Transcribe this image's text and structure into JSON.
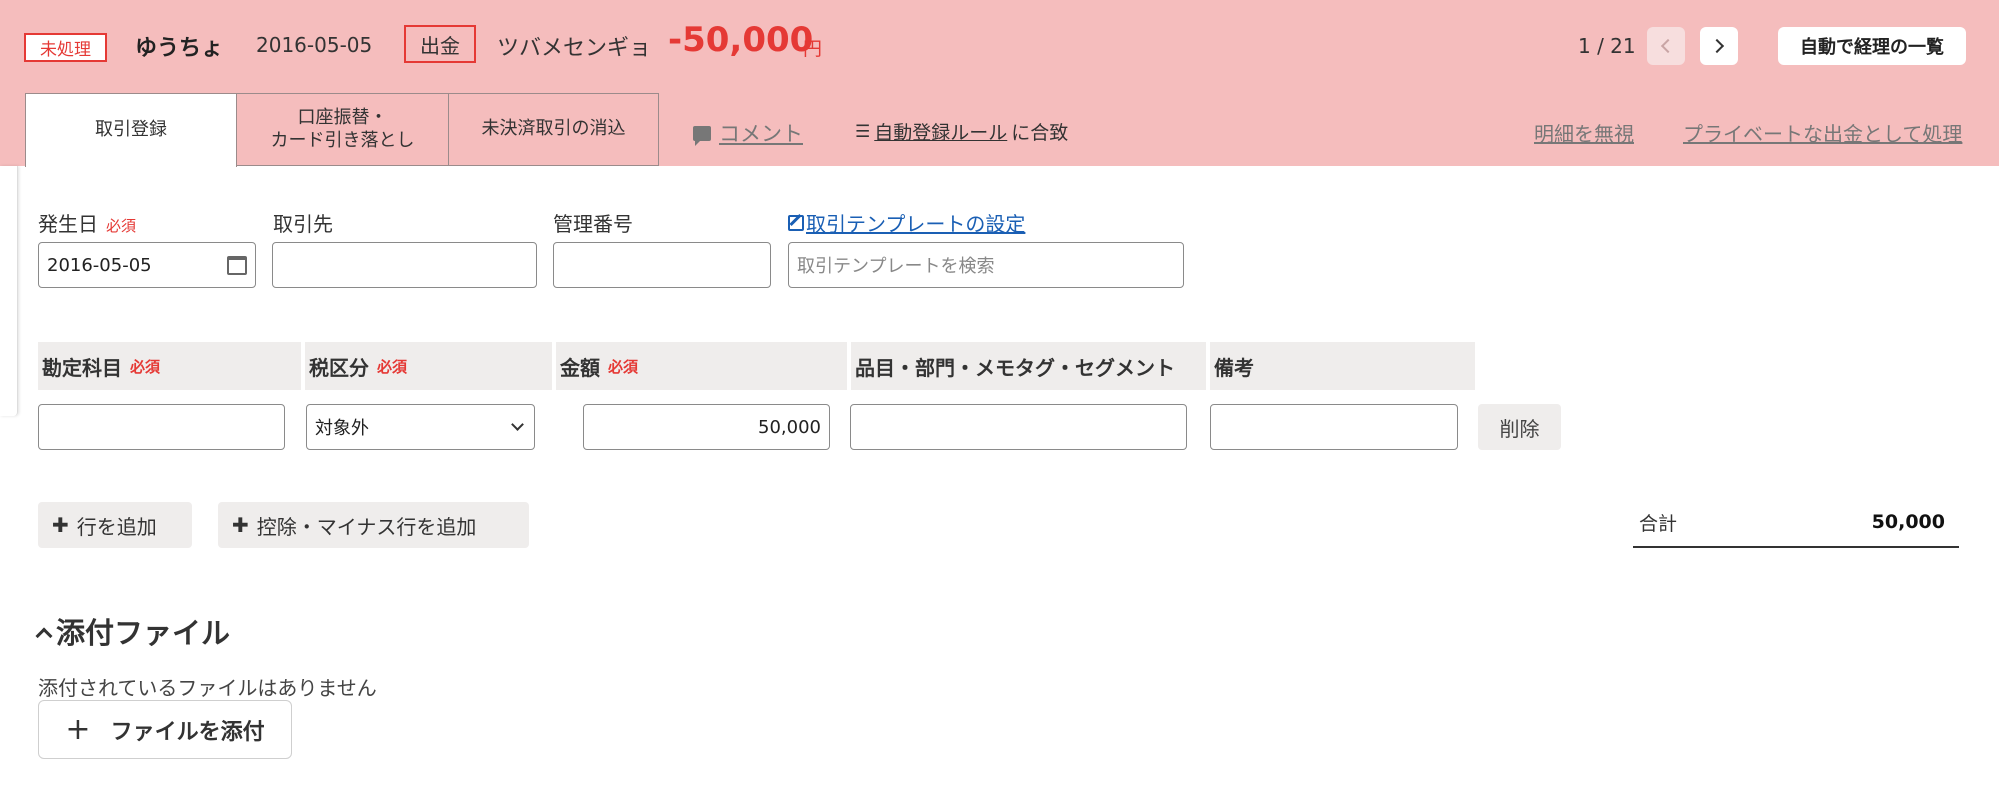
{
  "header": {
    "status": "未処理",
    "bank": "ゆうちょ",
    "date": "2016-05-05",
    "type": "出金",
    "payee": "ツバメセンギョ",
    "amount": "-50,000",
    "currency": "円",
    "pager": "1 / 21",
    "list_button": "自動で経理の一覧"
  },
  "tabs": [
    {
      "label": "取引登録",
      "active": true
    },
    {
      "label": "口座振替・\nカード引き落とし",
      "active": false
    },
    {
      "label": "未決済取引の消込",
      "active": false
    }
  ],
  "actions": {
    "comment": "コメント",
    "rule_link": "自動登録ルール",
    "rule_suffix": "に合致",
    "ignore": "明細を無視",
    "private": "プライベートな出金として処理"
  },
  "form": {
    "required": "必須",
    "date_label": "発生日",
    "date_value": "2016-05-05",
    "partner_label": "取引先",
    "partner_value": "",
    "mgmt_label": "管理番号",
    "mgmt_value": "",
    "template_link": "取引テンプレートの設定",
    "template_placeholder": "取引テンプレートを検索"
  },
  "table": {
    "headers": {
      "account": "勘定科目",
      "tax": "税区分",
      "amount": "金額",
      "items": "品目・部門・メモタグ・セグメント",
      "memo": "備考"
    },
    "row": {
      "account": "",
      "tax": "対象外",
      "amount": "50,000",
      "items": "",
      "memo": "",
      "delete": "削除"
    },
    "add_row": "行を追加",
    "add_minus_row": "控除・マイナス行を追加",
    "total_label": "合計",
    "total_value": "50,000"
  },
  "attachments": {
    "title": "添付ファイル",
    "empty": "添付されているファイルはありません",
    "button": "ファイルを添付"
  },
  "colors": {
    "header_bg": "#f5bdbd",
    "accent_red": "#e53935",
    "link_blue": "#1a5fb4"
  }
}
